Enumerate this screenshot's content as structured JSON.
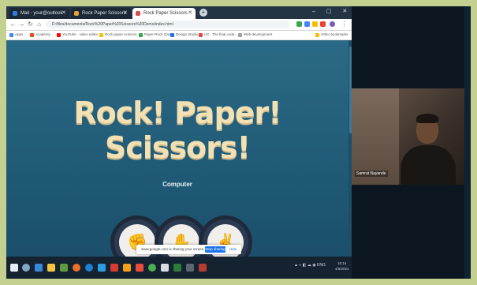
{
  "browser": {
    "tabs": [
      {
        "label": "Mail - your@outlook",
        "favicon_color": "#2f7de1"
      },
      {
        "label": "Rock Paper Scissors",
        "favicon_color": "#e8a13a"
      },
      {
        "label": "Rock Paper Scissors",
        "favicon_color": "#d94a4a"
      }
    ],
    "new_tab_label": "+",
    "window_controls": "– ▢ ✕",
    "url": "D:/files/documents/Rock%20Paper%20Scissors%20Demo/index.html",
    "bookmarks": [
      {
        "label": "Apps",
        "color": "#4285f4"
      },
      {
        "label": "Academy",
        "color": "#e64a19"
      },
      {
        "label": "YouTube · video editor",
        "color": "#ff0000"
      },
      {
        "label": "Rock paper scissors",
        "color": "#fbbc05"
      },
      {
        "label": "Paper Rock Game",
        "color": "#34a853"
      },
      {
        "label": "Design Studio",
        "color": "#1a73e8"
      },
      {
        "label": "UX · The final code...",
        "color": "#ea4335"
      },
      {
        "label": "Web development",
        "color": "#9aa0a6"
      }
    ],
    "other_bookmarks": "Other bookmarks"
  },
  "game": {
    "title": "Rock! Paper! Scissors!",
    "computer_label": "Computer",
    "choices": [
      {
        "name": "rock",
        "icon": "fist-hand-icon",
        "glyph": "✊"
      },
      {
        "name": "paper",
        "icon": "open-hand-icon",
        "glyph": "✋"
      },
      {
        "name": "scissors",
        "icon": "peace-hand-icon",
        "glyph": "✌"
      }
    ]
  },
  "share_bar": {
    "text": "www.google.com is sharing your screen.",
    "stop_label": "Stop sharing",
    "hide_label": "Hide"
  },
  "webcam": {
    "participant_name": "Samrat Nayande"
  },
  "taskbar": {
    "tray_text": "▲ ◐ ◧ ☁ ◉ ENG",
    "time": "10:14",
    "date": "4/5/2021"
  },
  "colors": {
    "page_background": "#2b6a86",
    "title": "#f3e0b3",
    "choice_ring": "#1e2a3c"
  }
}
